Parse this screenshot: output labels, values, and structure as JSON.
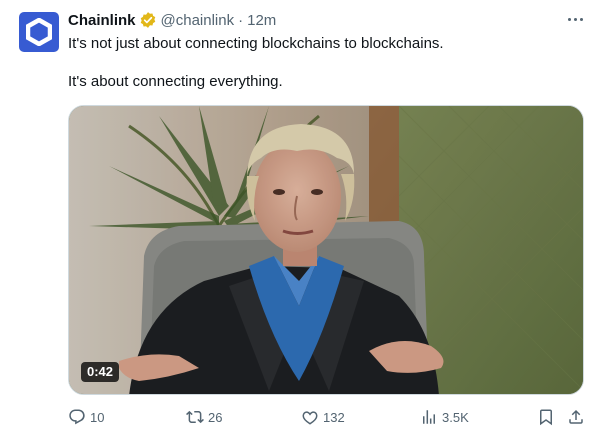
{
  "tweet": {
    "display_name": "Chainlink",
    "handle": "@chainlink",
    "separator": "·",
    "time": "12m",
    "line1": "It's not just about connecting blockchains to blockchains.",
    "line2": "It's about connecting everything.",
    "video_duration": "0:42",
    "verified_badge_color": "#e2b719",
    "avatar_color": "#375bd2"
  },
  "actions": {
    "replies": "10",
    "reposts": "26",
    "likes": "132",
    "views": "3.5K"
  },
  "icons": {
    "reply": "reply-icon",
    "repost": "repost-icon",
    "like": "like-icon",
    "views": "views-icon",
    "bookmark": "bookmark-icon",
    "share": "share-icon",
    "more": "more-icon"
  }
}
